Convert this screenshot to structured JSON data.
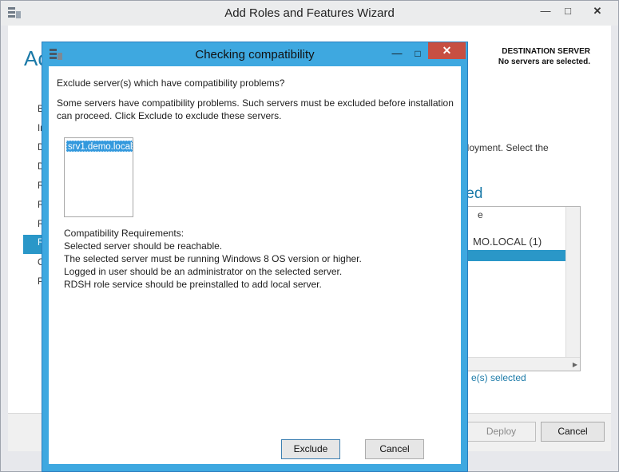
{
  "window": {
    "title": "Add Roles and Features Wizard",
    "page_title_partial": "Ac",
    "destination_label": "DESTINATION SERVER",
    "destination_value": "No servers are selected.",
    "nav_partial_items": [
      "B",
      "In",
      "D",
      "D",
      "R",
      "R",
      "R",
      "R",
      "C",
      "P"
    ],
    "selected_nav_index": 7,
    "right_text_partial": "ployment. Select the",
    "right_title_partial": "ted",
    "right_list_partial": [
      "e",
      "MO.LOCAL (1)"
    ],
    "selected_count_partial": "e(s) selected",
    "deploy_label": "Deploy",
    "cancel_label": "Cancel"
  },
  "dialog": {
    "title": "Checking compatibility",
    "question": "Exclude server(s) which have compatibility problems?",
    "description_line1": "Some servers have compatibility problems.  Such servers must be excluded before installation",
    "description_line2": "can proceed.  Click Exclude to exclude these servers.",
    "servers": [
      "srv1.demo.local"
    ],
    "requirements_title": "Compatibility Requirements:",
    "requirements": [
      "Selected server should be reachable.",
      "The selected server must be running Windows 8 OS version or higher.",
      "Logged in user should be an administrator on the selected server.",
      "RDSH role service should be preinstalled to add local server."
    ],
    "exclude_label": "Exclude",
    "cancel_label": "Cancel"
  },
  "colors": {
    "accent": "#2a97c8",
    "dialog_frame": "#3ea8e0",
    "close_button": "#c74f42"
  }
}
